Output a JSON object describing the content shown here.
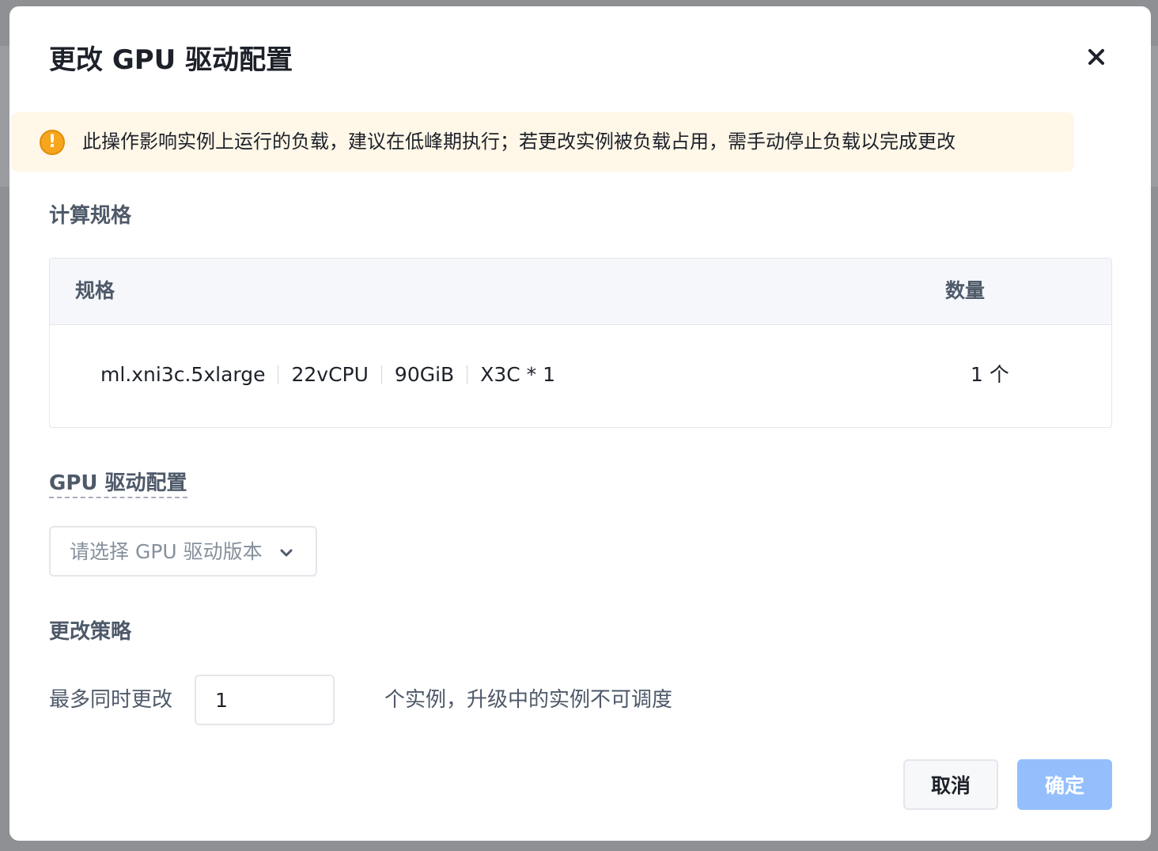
{
  "dialog": {
    "title": "更改 GPU 驱动配置"
  },
  "alert": {
    "icon": "warning-icon",
    "text": "此操作影响实例上运行的负载，建议在低峰期执行；若更改实例被负载占用，需手动停止负载以完成更改"
  },
  "compute_spec": {
    "label": "计算规格",
    "columns": [
      "规格",
      "数量"
    ],
    "rows": [
      {
        "spec": [
          "ml.xni3c.5xlarge",
          "22vCPU",
          "90GiB",
          "X3C * 1"
        ],
        "quantity": "1 个"
      }
    ]
  },
  "gpu_driver": {
    "label": "GPU 驱动配置",
    "placeholder": "请选择 GPU 驱动版本"
  },
  "strategy": {
    "label": "更改策略",
    "prefix": "最多同时更改",
    "value": "1",
    "suffix": "个实例，升级中的实例不可调度"
  },
  "footer": {
    "cancel_label": "取消",
    "ok_label": "确定"
  },
  "colors": {
    "primary_disabled": "#94bffc",
    "warning": "#f7a51c",
    "alert_bg": "#fff7e8"
  }
}
